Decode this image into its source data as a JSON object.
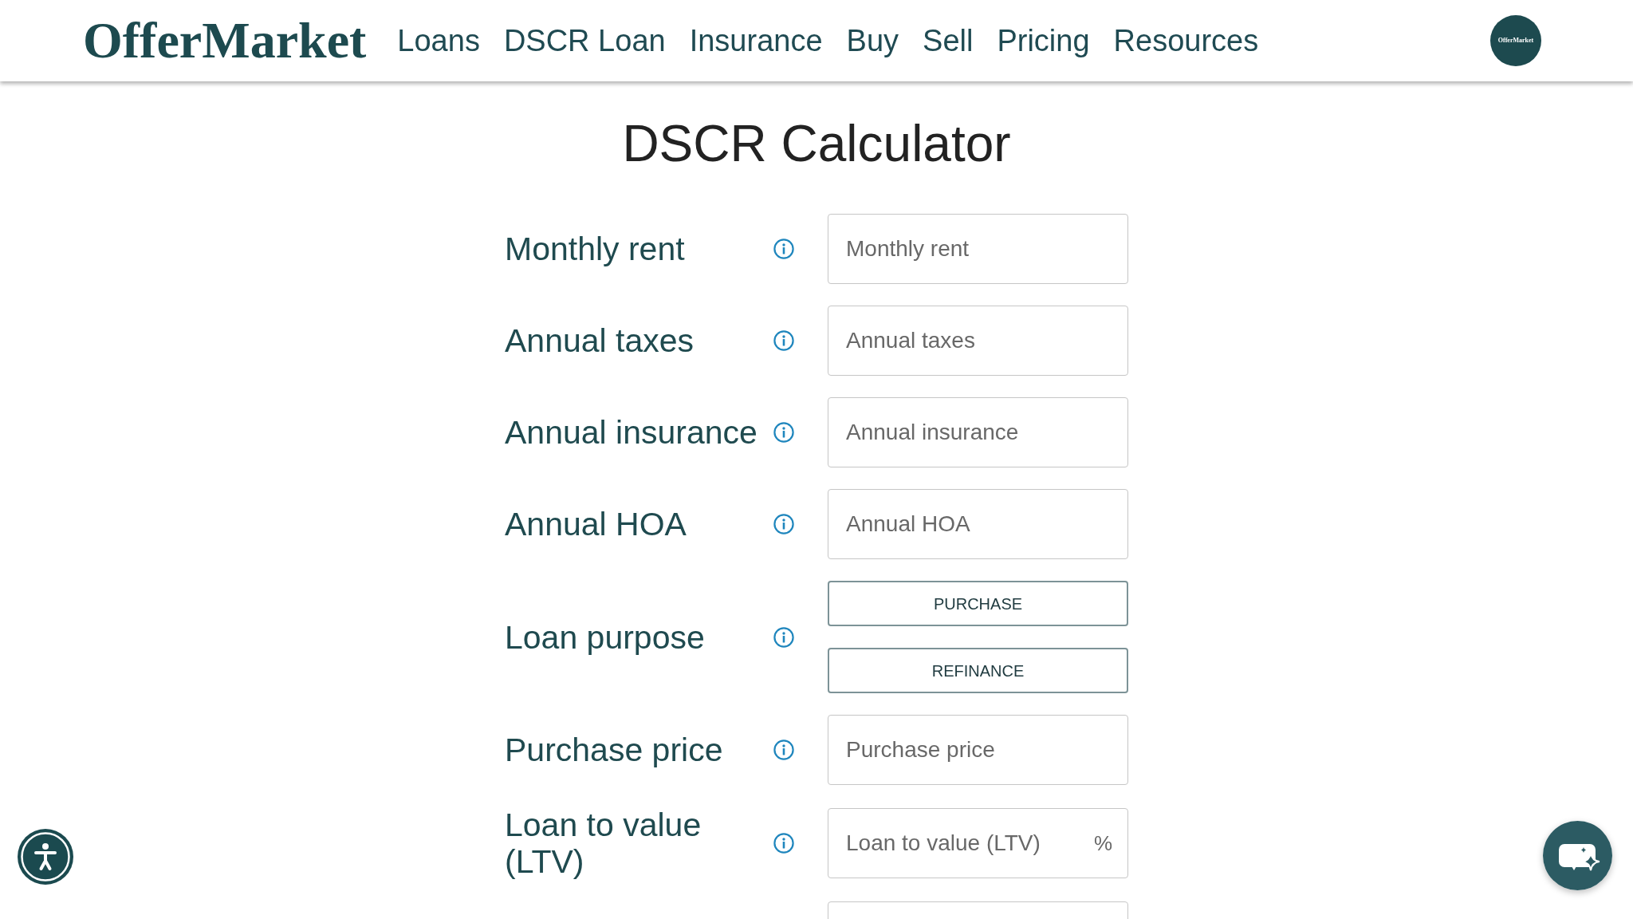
{
  "header": {
    "logo": "OfferMarket",
    "nav": [
      "Loans",
      "DSCR Loan",
      "Insurance",
      "Buy",
      "Sell",
      "Pricing",
      "Resources"
    ],
    "avatar": "OfferMarket"
  },
  "title": "DSCR Calculator",
  "form": {
    "rows": [
      {
        "kind": "input",
        "label": "Monthly rent",
        "placeholder": "Monthly rent"
      },
      {
        "kind": "input",
        "label": "Annual taxes",
        "placeholder": "Annual taxes"
      },
      {
        "kind": "input",
        "label": "Annual insurance",
        "placeholder": "Annual insurance"
      },
      {
        "kind": "input",
        "label": "Annual HOA",
        "placeholder": "Annual HOA"
      },
      {
        "kind": "choice",
        "label": "Loan purpose",
        "options": [
          {
            "label": "PURCHASE",
            "selected": false
          },
          {
            "label": "REFINANCE",
            "selected": false
          }
        ]
      },
      {
        "kind": "input",
        "label": "Purchase price",
        "placeholder": "Purchase price"
      },
      {
        "kind": "input",
        "label": "Loan to value (LTV)",
        "placeholder": "Loan to value (LTV)",
        "suffix": "%"
      },
      {
        "kind": "input"
      }
    ]
  }
}
